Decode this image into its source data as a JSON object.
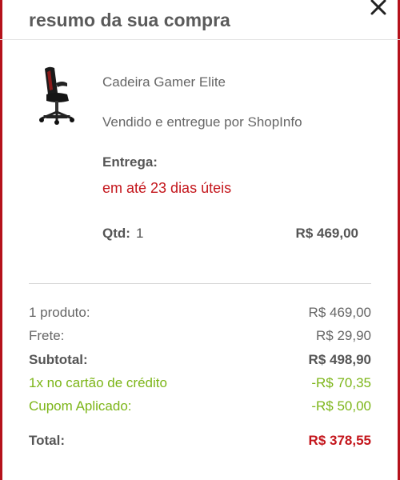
{
  "header": {
    "title": "resumo da sua compra",
    "close_icon": "close-icon"
  },
  "product": {
    "image_icon": "gamer-chair-image",
    "name": "Cadeira Gamer Elite",
    "seller": "Vendido e entregue por ShopInfo",
    "delivery_label": "Entrega:",
    "delivery_value": "em até 23 dias úteis",
    "qty_label": "Qtd:",
    "qty_value": "1",
    "price": "R$ 469,00"
  },
  "summary": {
    "products_label": "1 produto:",
    "products_value": "R$ 469,00",
    "shipping_label": "Frete:",
    "shipping_value": "R$ 29,90",
    "subtotal_label": "Subtotal:",
    "subtotal_value": "R$ 498,90",
    "card_discount_label": "1x no cartão de crédito",
    "card_discount_value": "-R$ 70,35",
    "coupon_label": "Cupom Aplicado:",
    "coupon_value": "-R$ 50,00",
    "total_label": "Total:",
    "total_value": "R$ 378,55"
  },
  "colors": {
    "brand_red": "#c4161c",
    "discount_green": "#7cb518",
    "text_gray": "#666666"
  }
}
